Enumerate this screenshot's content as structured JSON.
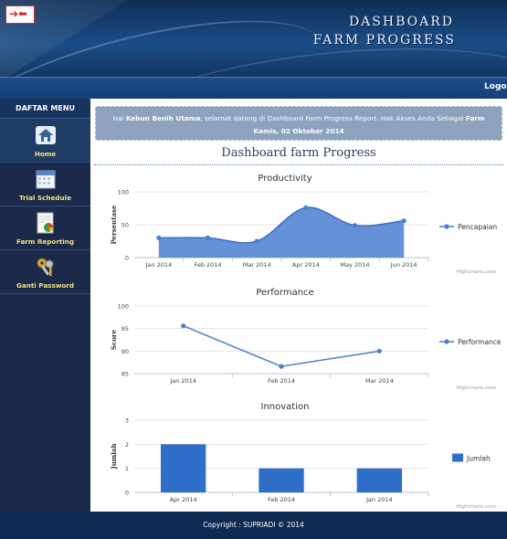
{
  "header": {
    "title_line1": "DASHBOARD",
    "title_line2": "FARM PROGRESS",
    "logout": "Logou"
  },
  "sidebar": {
    "title": "DAFTAR MENU",
    "items": [
      {
        "label": "Home",
        "icon": "home-icon"
      },
      {
        "label": "Trial Schedule",
        "icon": "calendar-icon"
      },
      {
        "label": "Farm Reporting",
        "icon": "report-chart-icon"
      },
      {
        "label": "Ganti Password",
        "icon": "keys-icon"
      }
    ]
  },
  "welcome": {
    "prefix": "Hai",
    "user": "Kebun Benih Utama",
    "message": ", selamat datang di Dashboard Farm Progress Report. Hak Akses Anda Sebagai",
    "role": "Farm",
    "date": "Kamis, 02 Oktober 2014"
  },
  "main": {
    "title": "Dashboard farm Progress"
  },
  "chart_data": [
    {
      "type": "area",
      "title": "Productivity",
      "ylabel": "Persentase",
      "categories": [
        "Jan 2014",
        "Feb 2014",
        "Mar 2014",
        "Apr 2014",
        "May 2014",
        "Jun 2014"
      ],
      "series": [
        {
          "name": "Pencapaian",
          "values": [
            30,
            30,
            25,
            76,
            49,
            56
          ]
        }
      ],
      "ylim": [
        0,
        100
      ],
      "yticks": [
        0,
        50,
        100
      ],
      "color": "#4a7fd0",
      "legend": "right",
      "credit": "Highcharts.com"
    },
    {
      "type": "line",
      "title": "Performance",
      "ylabel": "Score",
      "categories": [
        "Jan 2014",
        "Feb 2014",
        "Mar 2014"
      ],
      "series": [
        {
          "name": "Performance",
          "values": [
            95.6,
            86.6,
            90
          ]
        }
      ],
      "ylim": [
        85,
        100
      ],
      "yticks": [
        85,
        90,
        95,
        100
      ],
      "color": "#4a7fd0",
      "legend": "right",
      "credit": "Highcharts.com"
    },
    {
      "type": "bar",
      "title": "Innovation",
      "ylabel": "Jumlah",
      "categories": [
        "Apr 2014",
        "Feb 2014",
        "Jan 2014"
      ],
      "series": [
        {
          "name": "Jumlah",
          "values": [
            2,
            1,
            1
          ]
        }
      ],
      "ylim": [
        0,
        3
      ],
      "yticks": [
        0,
        1,
        2,
        3
      ],
      "color": "#2f6fc9",
      "legend": "right",
      "credit": "Highcharts.com"
    }
  ],
  "footer": {
    "copyright": "Copyright : SUPRIADI © 2014"
  }
}
